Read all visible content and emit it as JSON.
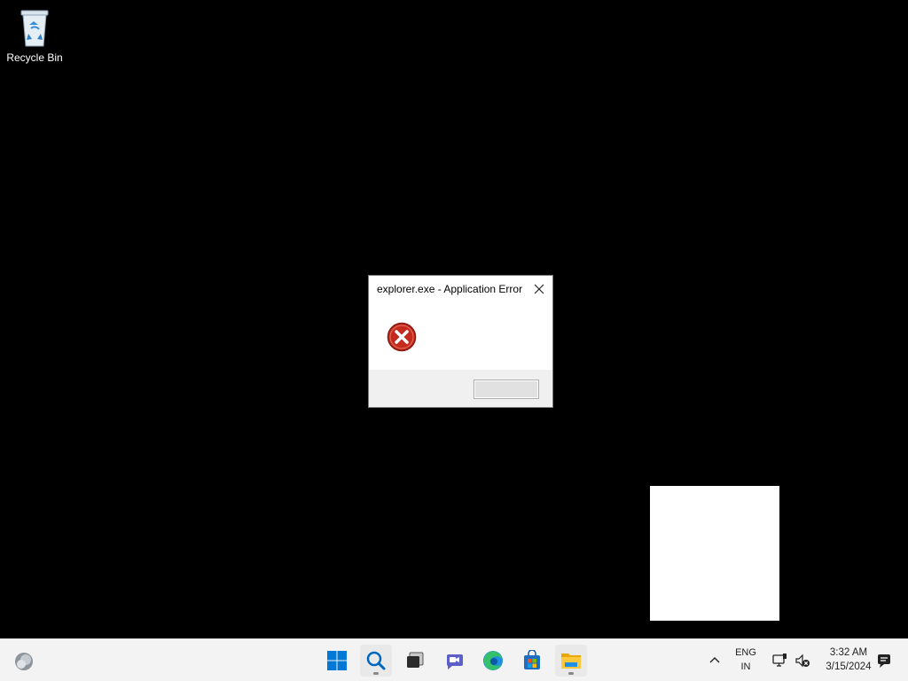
{
  "desktop": {
    "icons": [
      {
        "label": "Recycle Bin"
      }
    ]
  },
  "dialog": {
    "title": "explorer.exe - Application Error",
    "message": "",
    "ok_label": ""
  },
  "taskbar": {
    "items": [
      {
        "icon": "windows-start-icon"
      },
      {
        "icon": "search-icon"
      },
      {
        "icon": "task-view-icon"
      },
      {
        "icon": "chat-icon"
      },
      {
        "icon": "edge-icon"
      },
      {
        "icon": "store-icon"
      },
      {
        "icon": "file-explorer-icon"
      }
    ],
    "language": {
      "line1": "ENG",
      "line2": "IN"
    },
    "clock": {
      "time": "3:32 AM",
      "date": "3/15/2024"
    }
  },
  "colors": {
    "desktop_bg": "#000000",
    "taskbar_bg": "#f3f3f3",
    "error_red": "#c42b1c",
    "win_blue": "#0078d4"
  }
}
